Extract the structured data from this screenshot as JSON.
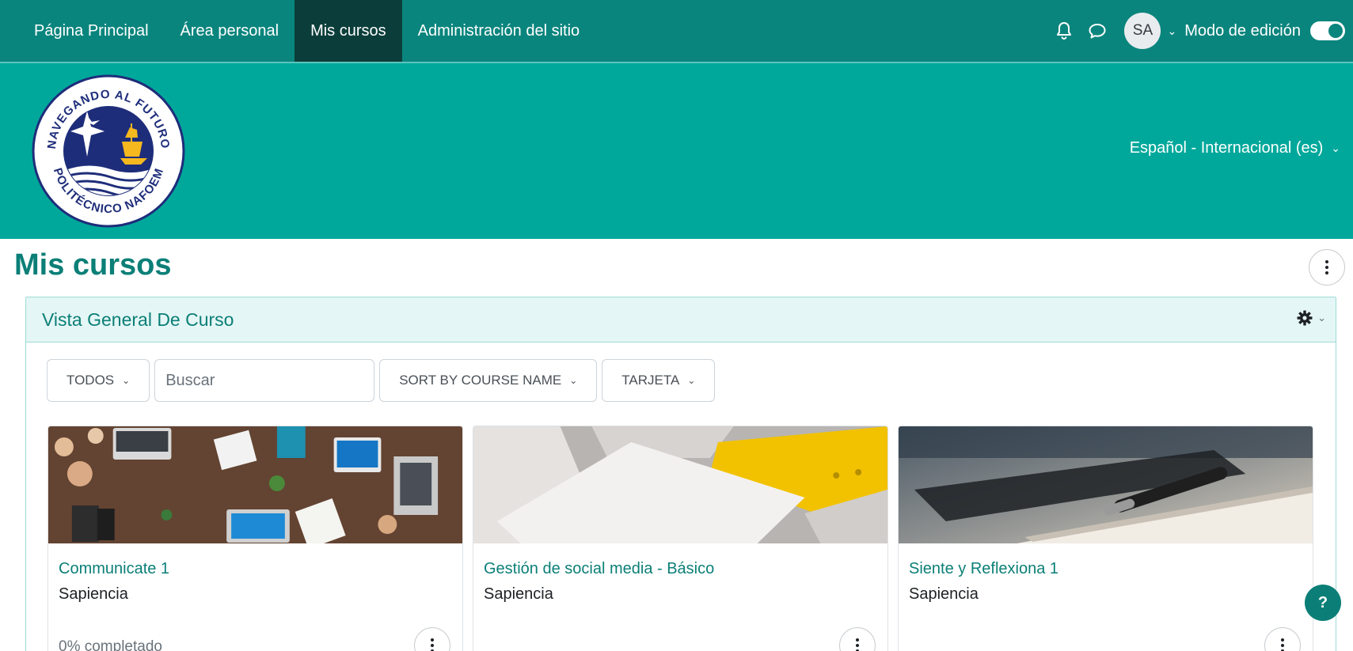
{
  "navbar": {
    "items": [
      {
        "label": "Página Principal",
        "active": false
      },
      {
        "label": "Área personal",
        "active": false
      },
      {
        "label": "Mis cursos",
        "active": true
      },
      {
        "label": "Administración del sitio",
        "active": false
      }
    ],
    "notifications_icon": "bell-icon",
    "messages_icon": "chat-bubble-icon",
    "user_initials": "SA",
    "edit_mode_label": "Modo de edición",
    "edit_mode_on": true
  },
  "header": {
    "logo": {
      "top_text": "NAVEGANDO AL FUTURO",
      "bottom_text": "POLITÉCNICO NAFOEM"
    },
    "language": "Español - Internacional (es)"
  },
  "page": {
    "title": "Mis cursos"
  },
  "block": {
    "title": "Vista General De Curso",
    "filters": {
      "grouping": "TODOS",
      "search_placeholder": "Buscar",
      "sort": "SORT BY COURSE NAME",
      "view": "TARJETA"
    },
    "courses": [
      {
        "name": "Communicate 1",
        "category": "Sapiencia",
        "progress_text": "0% completado",
        "progress": 0
      },
      {
        "name": "Gestión de social media - Básico",
        "category": "Sapiencia"
      },
      {
        "name": "Siente y Reflexiona 1",
        "category": "Sapiencia"
      }
    ]
  },
  "help_label": "?",
  "colors": {
    "navbar": "#0a857d",
    "navbar_active": "#0b3e3a",
    "banner": "#00a89b",
    "accent": "#0b7f77",
    "block_header": "#e4f6f5"
  }
}
